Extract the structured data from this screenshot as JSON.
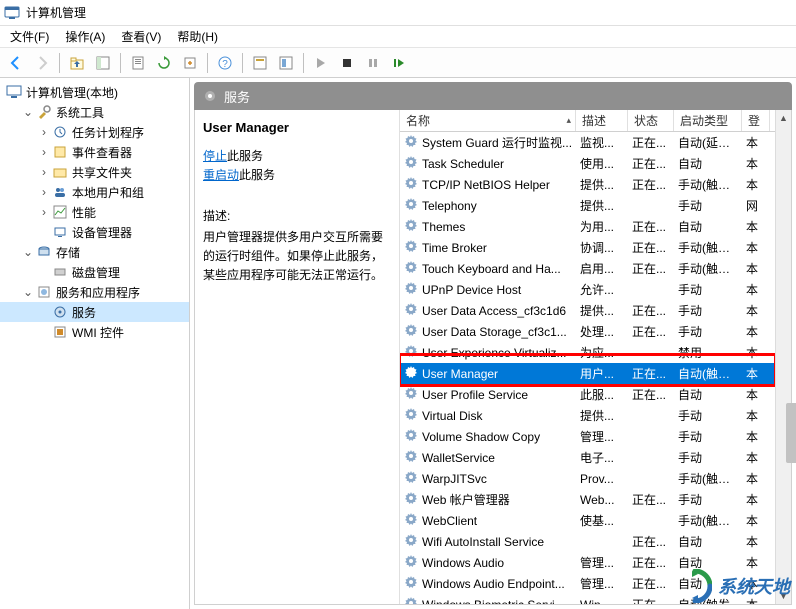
{
  "window": {
    "title": "计算机管理"
  },
  "menu": {
    "file": "文件(F)",
    "action": "操作(A)",
    "view": "查看(V)",
    "help": "帮助(H)"
  },
  "tree": {
    "root": "计算机管理(本地)",
    "system_tools": "系统工具",
    "task_scheduler": "任务计划程序",
    "event_viewer": "事件查看器",
    "shared_folders": "共享文件夹",
    "local_users": "本地用户和组",
    "performance": "性能",
    "device_manager": "设备管理器",
    "storage": "存储",
    "disk_mgmt": "磁盘管理",
    "services_apps": "服务和应用程序",
    "services": "服务",
    "wmi": "WMI 控件"
  },
  "right_header": "服务",
  "detail": {
    "title": "User Manager",
    "stop": "停止",
    "stop_suffix": "此服务",
    "restart": "重启动",
    "restart_suffix": "此服务",
    "desc_label": "描述:",
    "desc": "用户管理器提供多用户交互所需要的运行时组件。如果停止此服务，某些应用程序可能无法正常运行。"
  },
  "grid": {
    "headers": {
      "name": "名称",
      "desc": "描述",
      "state": "状态",
      "start": "启动类型",
      "login": "登"
    },
    "rows": [
      {
        "name": "System Guard 运行时监视...",
        "desc": "监视...",
        "state": "正在...",
        "start": "自动(延迟...",
        "login": "本"
      },
      {
        "name": "Task Scheduler",
        "desc": "使用...",
        "state": "正在...",
        "start": "自动",
        "login": "本"
      },
      {
        "name": "TCP/IP NetBIOS Helper",
        "desc": "提供...",
        "state": "正在...",
        "start": "手动(触发...",
        "login": "本"
      },
      {
        "name": "Telephony",
        "desc": "提供...",
        "state": "",
        "start": "手动",
        "login": "网"
      },
      {
        "name": "Themes",
        "desc": "为用...",
        "state": "正在...",
        "start": "自动",
        "login": "本"
      },
      {
        "name": "Time Broker",
        "desc": "协调...",
        "state": "正在...",
        "start": "手动(触发...",
        "login": "本"
      },
      {
        "name": "Touch Keyboard and Ha...",
        "desc": "启用...",
        "state": "正在...",
        "start": "手动(触发...",
        "login": "本"
      },
      {
        "name": "UPnP Device Host",
        "desc": "允许...",
        "state": "",
        "start": "手动",
        "login": "本"
      },
      {
        "name": "User Data Access_cf3c1d6",
        "desc": "提供...",
        "state": "正在...",
        "start": "手动",
        "login": "本"
      },
      {
        "name": "User Data Storage_cf3c1...",
        "desc": "处理...",
        "state": "正在...",
        "start": "手动",
        "login": "本"
      },
      {
        "name": "User Experience Virtualiz...",
        "desc": "为应...",
        "state": "",
        "start": "禁用",
        "login": "本"
      },
      {
        "name": "User Manager",
        "desc": "用户...",
        "state": "正在...",
        "start": "自动(触发...",
        "login": "本",
        "selected": true
      },
      {
        "name": "User Profile Service",
        "desc": "此服...",
        "state": "正在...",
        "start": "自动",
        "login": "本"
      },
      {
        "name": "Virtual Disk",
        "desc": "提供...",
        "state": "",
        "start": "手动",
        "login": "本"
      },
      {
        "name": "Volume Shadow Copy",
        "desc": "管理...",
        "state": "",
        "start": "手动",
        "login": "本"
      },
      {
        "name": "WalletService",
        "desc": "电子...",
        "state": "",
        "start": "手动",
        "login": "本"
      },
      {
        "name": "WarpJITSvc",
        "desc": "Prov...",
        "state": "",
        "start": "手动(触发...",
        "login": "本"
      },
      {
        "name": "Web 帐户管理器",
        "desc": "Web...",
        "state": "正在...",
        "start": "手动",
        "login": "本"
      },
      {
        "name": "WebClient",
        "desc": "使基...",
        "state": "",
        "start": "手动(触发...",
        "login": "本"
      },
      {
        "name": "Wifi AutoInstall Service",
        "desc": "",
        "state": "正在...",
        "start": "自动",
        "login": "本"
      },
      {
        "name": "Windows Audio",
        "desc": "管理...",
        "state": "正在...",
        "start": "自动",
        "login": "本"
      },
      {
        "name": "Windows Audio Endpoint...",
        "desc": "管理...",
        "state": "正在...",
        "start": "自动",
        "login": "本"
      },
      {
        "name": "Windows Biometric Servi",
        "desc": "Win",
        "state": "正在",
        "start": "自动(触发",
        "login": "本"
      }
    ]
  },
  "watermark": "系统天地"
}
